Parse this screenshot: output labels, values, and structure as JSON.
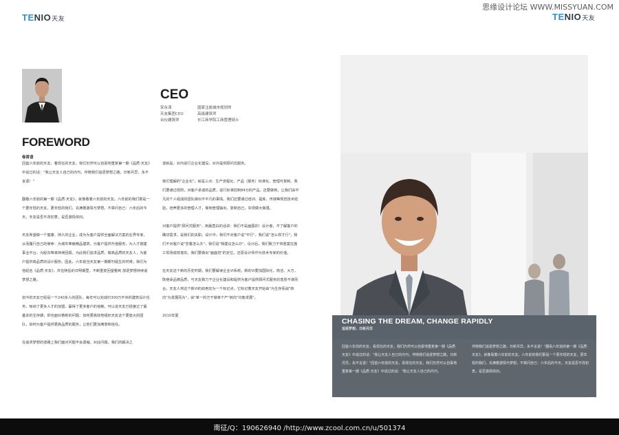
{
  "logo": {
    "accent": "TE",
    "rest": "NIO",
    "cn": "天友"
  },
  "watermark": "思缘设计论坛 WWW.MISSYUAN.COM",
  "ceo": {
    "title": "CEO",
    "info_left": [
      "宋永涛",
      "天友集团CEO",
      "合伙建筑师"
    ],
    "info_right": [
      "国家注册城市规划师",
      "高级建筑师",
      "长江商学院工商管理硕士"
    ]
  },
  "foreword": {
    "title": "FOREWORD",
    "subtitle": "卷首语",
    "col1": [
      "回首六年前的天友，看现在的天友，我们仍然可以自豪地重复第一期《品质·天友》中说过的话：\"我让天友人自己的内刊，伴随我们追逐梦想之路，日新月异，永不言退！\"",
      "翻看六年前的第一期《品质·天友》，就像看着六年前的天友。六年前的我们那是一个更年轻的天友，更年轻的我们，充满着激情与梦想。不禁问自己：六年后的今天，天友是否不改初衷，是否激情依旧。",
      "天友希望做一个健康、持久的企业，成为为客户提供全面解决方案的业界专家，从而履行自己的使命：为城市奉献精品建筑，为客户提供升值服务，为人才搭建事业平台，为股东带来持续回报。为此我们追求品质，做高品质的天友人，为客户提供高品质的设计服务。因此，六年前当天友第一期期刊诞生的时候，我们为他起名《品质·天友》，并在随后的日明期里，不断重复回望看到 放逐梦想持续追梦想之路。",
      "如今的天友已经是一个240多人的团队，每年可以完成约300万平米的建筑设计任务，吸纳了更多人才的加盟，赢得了更多客户的信赖。可以说天友已经度过了最基本的生存期，却也面对着新的问题：如何更高效地组织天友这个更庞大的团队，如何为客户提供更高品质的服务，让他们更加满意和信任。",
      "在追求梦想的道路上我们面对问题不会退缩。对此问题，我们的解决之"
    ],
    "col2": [
      "道就是，对内进行企业化建设，对外提供顾问式服务。",
      "我们理解的\"企业化\"，就是三点：生产流程化、产品（服务）标准化、管理可复制。我们要通过规则，对客户承诺的品质，进行标准控制84分的产品。还要做到，让我们由平凡的个人组成的团队做出不平凡的事情。我们还要通过培训、提炼、传授等规范技术经验，培养更多的管理人才，做到管理输出，复制自己，实现做大做强。",
      "对客户提供\"顾问式服务\"，用最直白的话讲：我们不是画图的！设计者，不了解客户的确切需求，是我们的失职。设计中，我们不对客户说\"不行\"，我们说\"怎么样才行\"；我们不对客户说\"您看怎么办\"，我们说\"我建议怎么办\"。设计后，我们致力于将答案在施工现场成效落实。我们要做出\"画面范\"的定位，还原设计师作为技术专家的价值。",
      "在天友这个新的历史时期，我们要解读企业VI系统。新的VI要加国际化，简洁、大方，既继承品牌品质，与天友致力于企业化建设和提供为客户提供顾问式服务的意愿不谋而合。天友人将这个新VI的启用定为一个标记点，它标记着天友开始由\"为生存而战\"转向\"为发展而为\"，由\"单一的方于做单个产\"转向\"均衡发展\"。",
      "2010年夏"
    ]
  },
  "feature": {
    "title": "CHASING THE DREAM, CHANGE RAPIDLY",
    "subtitle": "追逐梦想，日新月异",
    "col1": "回首六年前的天友，看现在的天友，我们仍然可以自豪地重复第一期《品质·天友》中说过的话：\"我让天友人自己的内刊，伴随我们追逐梦想之路，日新月异，永不言退！\"回首六年前的天友，看现在的天友，我们仍然可以自豪地重复第一期《品质·天友》中说过的话：\"我让天友人自己的内刊，",
    "col2": "伴随我们追逐梦想之路，日新月异，永不言退！\"翻看六年前的第一期《品质·天友》，就像看着六年前的天友。六年前的我们那是一个更年轻的天友，更年轻的我们，充满着激情与梦想。不禁问自己：六年后的今天，天友是否不改初衷，是否激情依旧。"
  },
  "footer": {
    "text": "南征/Q：190626940 /http://www.zcool.com.cn/u/501374"
  }
}
